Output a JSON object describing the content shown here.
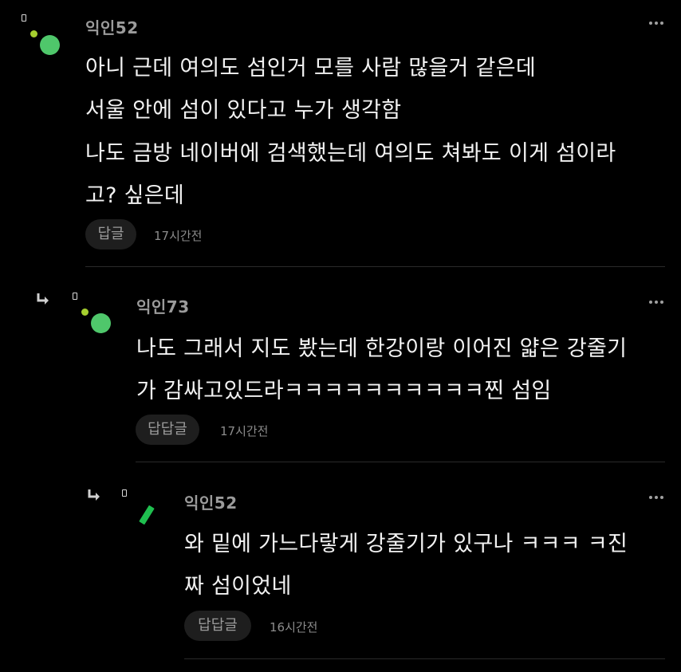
{
  "comments": [
    {
      "nickname": "익인52",
      "lines": [
        "아니 근데 여의도 섬인거 모를 사람 많을거 같은데",
        "서울 안에 섬이 있다고 누가 생각함",
        "나도 금방 네이버에 검색했는데 여의도 쳐봐도 이게 섬이라",
        "고? 싶은데"
      ],
      "reply_label": "답글",
      "time": "17시간전"
    },
    {
      "nickname": "익인73",
      "lines": [
        "나도 그래서 지도 봤는데 한강이랑 이어진 얇은 강줄기",
        "가 감싸고있드라ㅋㅋㅋㅋㅋㅋㅋㅋㅋㅋ찐 섬임"
      ],
      "reply_label": "답답글",
      "time": "17시간전"
    },
    {
      "nickname": "익인52",
      "lines": [
        "와 밑에 가느다랗게 강줄기가 있구나 ㅋㅋㅋ ㅋ진",
        "짜 섬이었네"
      ],
      "reply_label": "답답글",
      "time": "16시간전"
    }
  ],
  "icons": {
    "more": "more-dots-icon",
    "reply_arrow": "reply-arrow-icon",
    "avatar": "avatar-icon"
  },
  "colors": {
    "background": "#000000",
    "avatar_green": "#4fc76b",
    "avatar_lime": "#a6cf2f",
    "bar_green": "#1fbf4f"
  }
}
